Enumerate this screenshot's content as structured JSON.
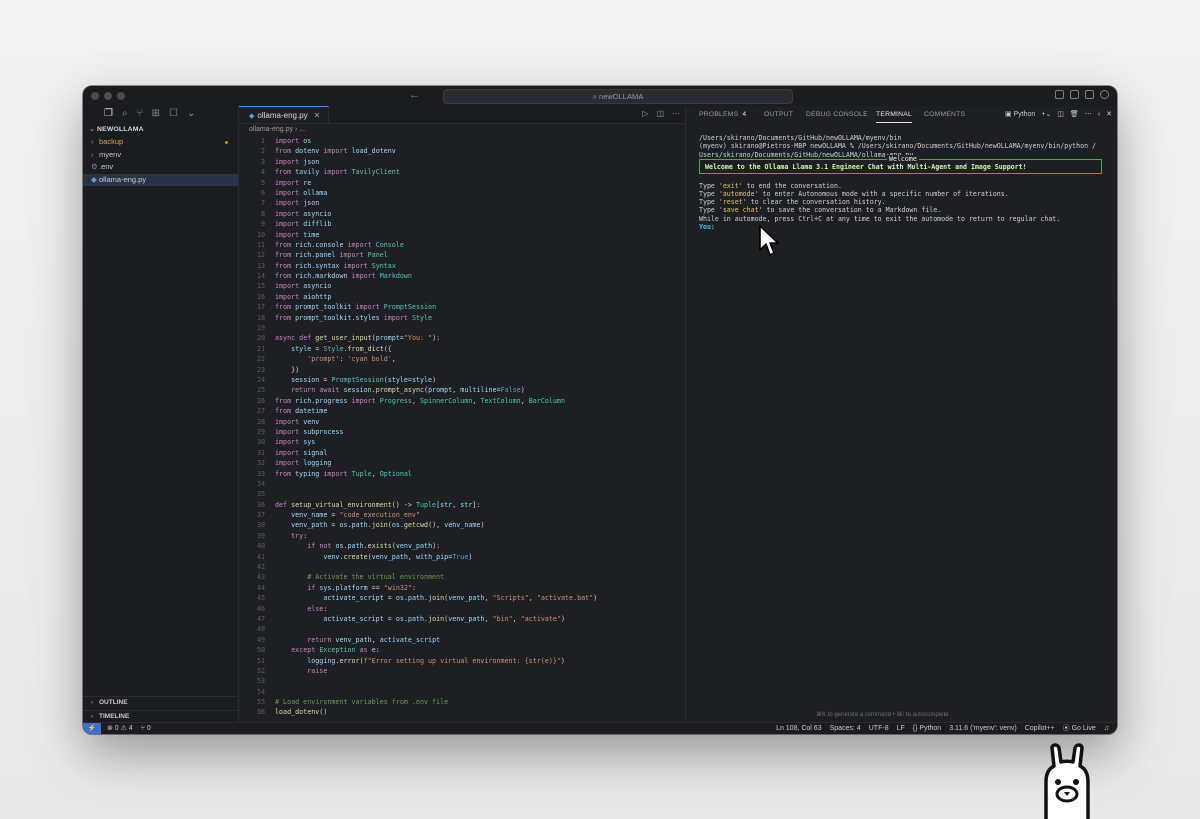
{
  "window": {
    "search_text": "⌕ newOLLAMA",
    "nav_back": "←",
    "nav_forward": "→"
  },
  "sidebar": {
    "root": "NEWOLLAMA",
    "items": [
      {
        "chev": "›",
        "label": "backup",
        "modified": true
      },
      {
        "chev": "›",
        "label": "myenv",
        "modified": false
      },
      {
        "chev": "⚙",
        "label": ".env",
        "modified": false
      },
      {
        "chev": "◆",
        "label": "ollama-eng.py",
        "modified": false
      }
    ],
    "outline": "OUTLINE",
    "timeline": "TIMELINE"
  },
  "editor": {
    "tab_label": "ollama-eng.py",
    "breadcrumb": "ollama-eng.py › ...",
    "lines": [
      {
        "n": "1",
        "t": "import os"
      },
      {
        "n": "2",
        "t": "from dotenv import load_dotenv"
      },
      {
        "n": "3",
        "t": "import json"
      },
      {
        "n": "4",
        "t": "from tavily import TavilyClient"
      },
      {
        "n": "5",
        "t": "import re"
      },
      {
        "n": "6",
        "t": "import ollama"
      },
      {
        "n": "7",
        "t": "import json"
      },
      {
        "n": "8",
        "t": "import asyncio"
      },
      {
        "n": "9",
        "t": "import difflib"
      },
      {
        "n": "10",
        "t": "import time"
      },
      {
        "n": "11",
        "t": "from rich.console import Console"
      },
      {
        "n": "12",
        "t": "from rich.panel import Panel"
      },
      {
        "n": "13",
        "t": "from rich.syntax import Syntax"
      },
      {
        "n": "14",
        "t": "from rich.markdown import Markdown"
      },
      {
        "n": "15",
        "t": "import asyncio"
      },
      {
        "n": "16",
        "t": "import aiohttp"
      },
      {
        "n": "17",
        "t": "from prompt_toolkit import PromptSession"
      },
      {
        "n": "18",
        "t": "from prompt_toolkit.styles import Style"
      },
      {
        "n": "19",
        "t": ""
      },
      {
        "n": "20",
        "t": "async def get_user_input(prompt=\"You: \"):"
      },
      {
        "n": "21",
        "t": "    style = Style.from_dict({"
      },
      {
        "n": "22",
        "t": "        'prompt': 'cyan bold',"
      },
      {
        "n": "23",
        "t": "    })"
      },
      {
        "n": "24",
        "t": "    session = PromptSession(style=style)"
      },
      {
        "n": "25",
        "t": "    return await session.prompt_async(prompt, multiline=False)"
      },
      {
        "n": "26",
        "t": "from rich.progress import Progress, SpinnerColumn, TextColumn, BarColumn"
      },
      {
        "n": "27",
        "t": "from datetime"
      },
      {
        "n": "28",
        "t": "import venv"
      },
      {
        "n": "29",
        "t": "import subprocess"
      },
      {
        "n": "30",
        "t": "import sys"
      },
      {
        "n": "31",
        "t": "import signal"
      },
      {
        "n": "32",
        "t": "import logging"
      },
      {
        "n": "33",
        "t": "from typing import Tuple, Optional"
      },
      {
        "n": "34",
        "t": ""
      },
      {
        "n": "35",
        "t": ""
      },
      {
        "n": "36",
        "t": "def setup_virtual_environment() -> Tuple[str, str]:"
      },
      {
        "n": "37",
        "t": "    venv_name = \"code_execution_env\""
      },
      {
        "n": "38",
        "t": "    venv_path = os.path.join(os.getcwd(), venv_name)"
      },
      {
        "n": "39",
        "t": "    try:"
      },
      {
        "n": "40",
        "t": "        if not os.path.exists(venv_path):"
      },
      {
        "n": "41",
        "t": "            venv.create(venv_path, with_pip=True)"
      },
      {
        "n": "42",
        "t": ""
      },
      {
        "n": "43",
        "t": "        # Activate the virtual environment"
      },
      {
        "n": "44",
        "t": "        if sys.platform == \"win32\":"
      },
      {
        "n": "45",
        "t": "            activate_script = os.path.join(venv_path, \"Scripts\", \"activate.bat\")"
      },
      {
        "n": "46",
        "t": "        else:"
      },
      {
        "n": "47",
        "t": "            activate_script = os.path.join(venv_path, \"bin\", \"activate\")"
      },
      {
        "n": "48",
        "t": ""
      },
      {
        "n": "49",
        "t": "        return venv_path, activate_script"
      },
      {
        "n": "50",
        "t": "    except Exception as e:"
      },
      {
        "n": "51",
        "t": "        logging.error(f\"Error setting up virtual environment: {str(e)}\")"
      },
      {
        "n": "52",
        "t": "        raise"
      },
      {
        "n": "53",
        "t": ""
      },
      {
        "n": "54",
        "t": ""
      },
      {
        "n": "55",
        "t": "# Load environment variables from .env file"
      },
      {
        "n": "56",
        "t": "load_dotenv()"
      }
    ]
  },
  "panel": {
    "tabs": [
      {
        "label": "PROBLEMS",
        "badge": "4"
      },
      {
        "label": "OUTPUT",
        "badge": ""
      },
      {
        "label": "DEBUG CONSOLE",
        "badge": ""
      },
      {
        "label": "TERMINAL",
        "badge": ""
      },
      {
        "label": "COMMENTS",
        "badge": ""
      }
    ],
    "shell_label": "Python",
    "terminal": {
      "line1": "/Users/skirano/Documents/GitHub/newOLLAMA/myenv/bin",
      "line2": "(myenv) skirano@Pietros-MBP newOLLAMA % /Users/skirano/Documents/GitHub/newOLLAMA/myenv/bin/python /",
      "line3": "Users/skirano/Documents/GitHub/newOLLAMA/ollama-eng.py",
      "welcome_title": "Welcome",
      "welcome_msg": "Welcome to the Ollama Llama 3.1 Engineer Chat with Multi-Agent and Image Support!",
      "help": [
        {
          "pre": "Type ",
          "q": "'exit'",
          "post": " to end the conversation."
        },
        {
          "pre": "Type ",
          "q": "'automode'",
          "post": " to enter Autonomous mode with a specific number of iterations."
        },
        {
          "pre": "Type ",
          "q": "'reset'",
          "post": " to clear the conversation history."
        },
        {
          "pre": "Type ",
          "q": "'save chat'",
          "post": " to save the conversation to a Markdown file."
        },
        {
          "pre": "While in automode, press Ctrl+C at any time to exit the automode to return to regular chat.",
          "q": "",
          "post": ""
        }
      ],
      "prompt": "You:",
      "hint": "⌘K to generate a command • ⌘/ to autocomplete"
    }
  },
  "statusbar": {
    "remote": "⚡",
    "problems": "⊗ 0 ⚠ 4",
    "ports": "⑂ 0",
    "position": "Ln 108, Col 63",
    "spaces": "Spaces: 4",
    "encoding": "UTF-8",
    "eol": "LF",
    "language": "{} Python",
    "interpreter": "3.11.6 ('myenv': venv)",
    "copilot": "Copilot++",
    "golive": "⦿ Go Live",
    "bell": "♫"
  }
}
